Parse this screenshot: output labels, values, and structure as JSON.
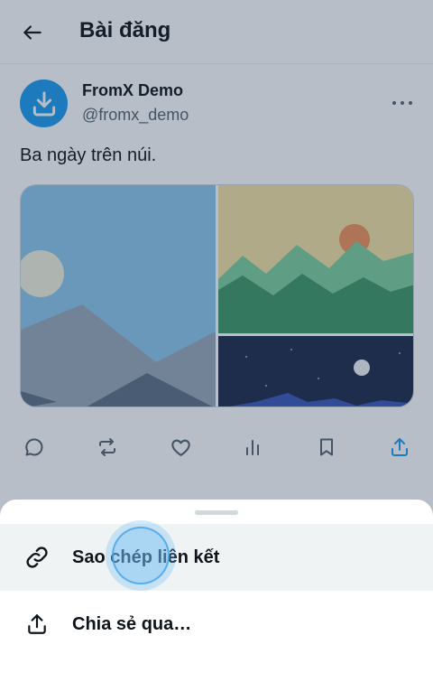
{
  "header": {
    "title": "Bài đăng",
    "back_icon": "arrow-left-icon"
  },
  "post": {
    "author_name": "FromX Demo",
    "author_handle": "@fromx_demo",
    "avatar_icon": "download-icon",
    "text": "Ba ngày trên núi.",
    "media": [
      {
        "name": "media-mountain-day",
        "kind": "image"
      },
      {
        "name": "media-mountain-sunset",
        "kind": "image"
      },
      {
        "name": "media-mountain-night",
        "kind": "image"
      }
    ]
  },
  "actions": [
    {
      "name": "reply-button",
      "icon": "comment-icon"
    },
    {
      "name": "repost-button",
      "icon": "repost-icon"
    },
    {
      "name": "like-button",
      "icon": "heart-icon"
    },
    {
      "name": "views-button",
      "icon": "bar-chart-icon"
    },
    {
      "name": "bookmark-button",
      "icon": "bookmark-icon"
    },
    {
      "name": "share-button",
      "icon": "share-icon"
    }
  ],
  "share_sheet": {
    "items": [
      {
        "label": "Sao chép liên kết",
        "icon": "link-icon"
      },
      {
        "label": "Chia sẻ qua…",
        "icon": "share-icon"
      }
    ]
  },
  "colors": {
    "accent": "#1d9bf0",
    "text": "#0f1419",
    "secondary": "#536471",
    "sheet_highlight": "#eff3f4"
  }
}
